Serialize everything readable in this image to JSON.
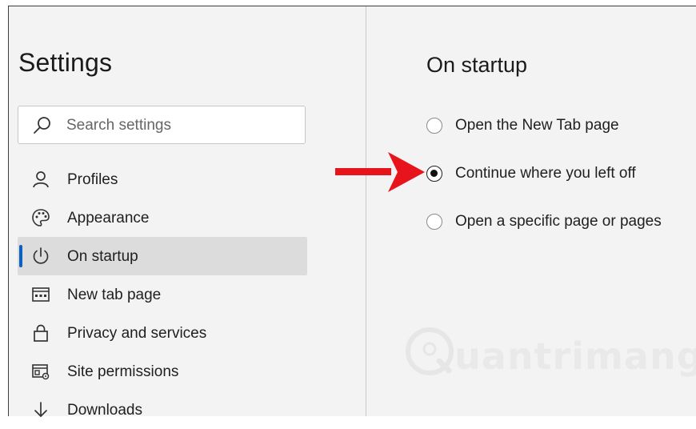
{
  "sidebar": {
    "title": "Settings",
    "search": {
      "placeholder": "Search settings"
    },
    "items": [
      {
        "label": "Profiles",
        "icon": "profile-icon",
        "active": false
      },
      {
        "label": "Appearance",
        "icon": "palette-icon",
        "active": false
      },
      {
        "label": "On startup",
        "icon": "power-icon",
        "active": true
      },
      {
        "label": "New tab page",
        "icon": "new-tab-page-icon",
        "active": false
      },
      {
        "label": "Privacy and services",
        "icon": "lock-icon",
        "active": false
      },
      {
        "label": "Site permissions",
        "icon": "site-permissions-icon",
        "active": false
      },
      {
        "label": "Downloads",
        "icon": "download-arrow-icon",
        "active": false
      }
    ],
    "accent_color": "#0f5fbf"
  },
  "main": {
    "title": "On startup",
    "options": [
      {
        "label": "Open the New Tab page",
        "selected": false
      },
      {
        "label": "Continue where you left off",
        "selected": true
      },
      {
        "label": "Open a specific page or pages",
        "selected": false
      }
    ]
  },
  "annotation": {
    "arrow_color": "#e8141b"
  },
  "watermark": {
    "text": "uantrimang"
  }
}
